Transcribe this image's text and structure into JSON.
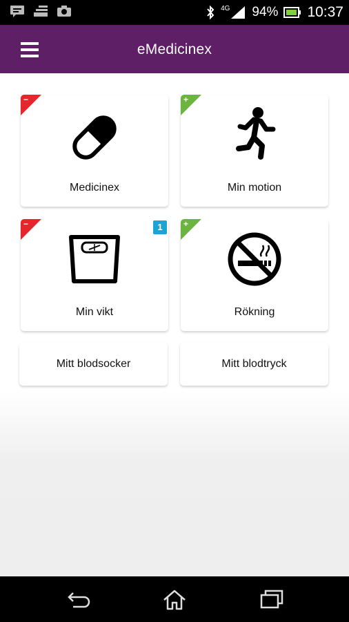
{
  "status_bar": {
    "network": "4G",
    "battery": "94%",
    "time": "10:37"
  },
  "app_bar": {
    "title": "eMedicinex"
  },
  "tiles": [
    {
      "label": "Medicinex",
      "corner": "−",
      "icon": "pill-icon"
    },
    {
      "label": "Min motion",
      "corner": "+",
      "icon": "running-person-icon"
    },
    {
      "label": "Min vikt",
      "corner": "−",
      "icon": "scale-icon",
      "badge": "1"
    },
    {
      "label": "Rökning",
      "corner": "+",
      "icon": "no-smoking-icon"
    }
  ],
  "wide_buttons": [
    {
      "label": "Mitt blodsocker"
    },
    {
      "label": "Mitt blodtryck"
    }
  ],
  "colors": {
    "app_bar": "#5e1f66",
    "corner_red": "#e5272d",
    "corner_green": "#6cb33f",
    "badge": "#1ea3d2"
  }
}
